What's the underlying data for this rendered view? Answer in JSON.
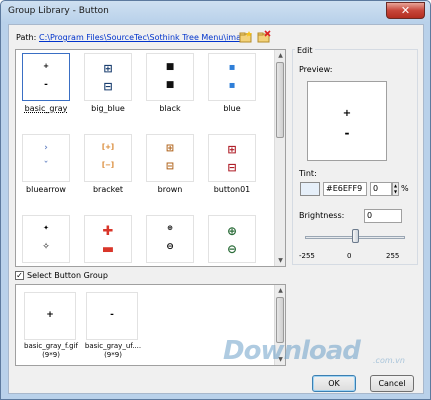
{
  "window": {
    "title": "Group Library - Button",
    "close_glyph": "✕"
  },
  "toolbar": {
    "path_label": "Path:",
    "path_value": "C:\\Program Files\\SourceTec\\Sothink Tree Menu\\ima...",
    "icons": [
      "new-folder-icon",
      "delete-folder-icon"
    ]
  },
  "library": {
    "items": [
      {
        "label": "basic_gray",
        "top": "+",
        "bottom": "-",
        "style": "plain",
        "selected": true
      },
      {
        "label": "big_blue",
        "top": "⊞",
        "bottom": "⊟",
        "style": "bigblue"
      },
      {
        "label": "black",
        "top": "■",
        "bottom": "■",
        "style": "black"
      },
      {
        "label": "blue",
        "top": "▪",
        "bottom": "▪",
        "style": "blue"
      },
      {
        "label": "bluearrow",
        "top": "›",
        "bottom": "ˇ",
        "style": "arrow"
      },
      {
        "label": "bracket",
        "top": "[+]",
        "bottom": "[−]",
        "style": "bracket"
      },
      {
        "label": "brown",
        "top": "⊞",
        "bottom": "⊟",
        "style": "brown"
      },
      {
        "label": "button01",
        "top": "⊞",
        "bottom": "⊟",
        "style": "red"
      },
      {
        "label": "",
        "top": "✦",
        "bottom": "✧",
        "style": "plain"
      },
      {
        "label": "",
        "top": "✚",
        "bottom": "▬",
        "style": "redbig"
      },
      {
        "label": "",
        "top": "⊕",
        "bottom": "⊖",
        "style": "plain"
      },
      {
        "label": "",
        "top": "⊕",
        "bottom": "⊖",
        "style": "green"
      }
    ]
  },
  "select_group": {
    "label": "Select Button Group",
    "checked": true,
    "check_glyph": "✓"
  },
  "group": {
    "items": [
      {
        "symbol": "+",
        "label1": "basic_gray_f.gif",
        "label2": "(9*9)"
      },
      {
        "symbol": "-",
        "label1": "basic_gray_uf....",
        "label2": "(9*9)"
      }
    ]
  },
  "edit": {
    "legend": "Edit",
    "preview_label": "Preview:",
    "preview_top": "+",
    "preview_bottom": "-",
    "tint_label": "Tint:",
    "tint_color": "#E6EFF9",
    "tint_value": "#E6EFF9",
    "tint_percent": "0",
    "percent_sign": "%",
    "brightness_label": "Brightness:",
    "brightness_value": "0",
    "brightness_min": "-255",
    "brightness_mid": "0",
    "brightness_max": "255",
    "brightness_level": 0,
    "brightness_range": [
      -255,
      255
    ]
  },
  "buttons": {
    "ok": "OK",
    "cancel": "Cancel"
  },
  "watermark": {
    "text": "Download",
    "sub": ".com.vn"
  }
}
